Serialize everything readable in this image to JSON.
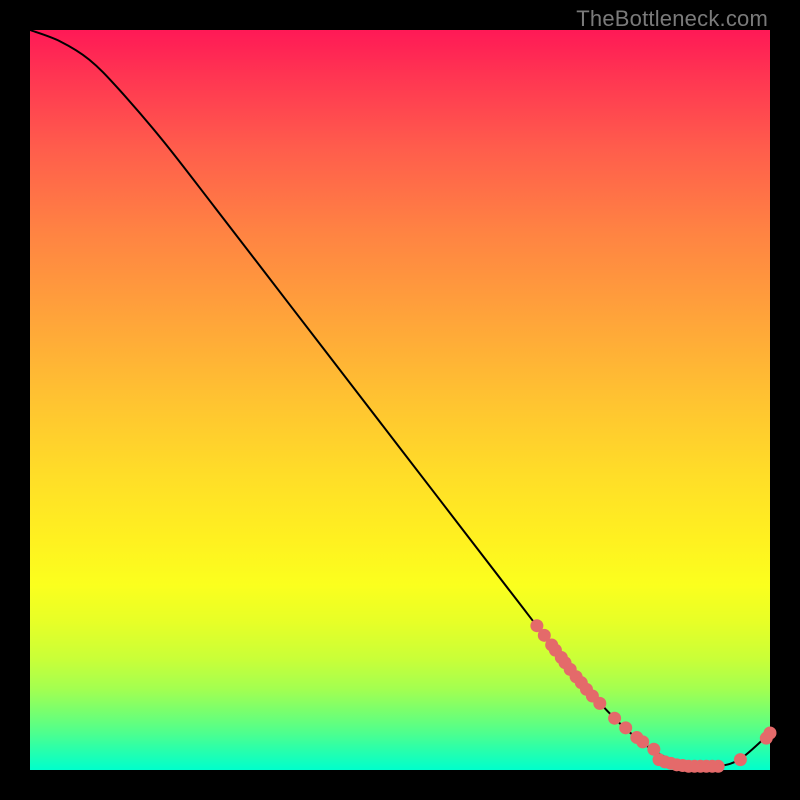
{
  "watermark": "TheBottleneck.com",
  "colors": {
    "background": "#000000",
    "marker": "#e46a6a",
    "curve": "#000000"
  },
  "chart_data": {
    "type": "line",
    "title": "",
    "xlabel": "",
    "ylabel": "",
    "xlim": [
      0,
      100
    ],
    "ylim": [
      0,
      100
    ],
    "grid": false,
    "series": [
      {
        "name": "curve",
        "x": [
          0,
          4,
          8,
          12,
          18,
          25,
          35,
          45,
          55,
          65,
          72,
          78,
          83,
          87,
          90,
          93,
          96,
          100
        ],
        "y": [
          100,
          98.5,
          96,
          92,
          85,
          76,
          63,
          50,
          37,
          24,
          15,
          8,
          3.5,
          1.2,
          0.5,
          0.5,
          1.5,
          5
        ]
      }
    ],
    "markers": {
      "name": "highlighted-points",
      "points": [
        {
          "x": 68.5,
          "y": 19.5
        },
        {
          "x": 69.5,
          "y": 18.2
        },
        {
          "x": 70.5,
          "y": 16.9
        },
        {
          "x": 71.0,
          "y": 16.2
        },
        {
          "x": 71.8,
          "y": 15.2
        },
        {
          "x": 72.3,
          "y": 14.5
        },
        {
          "x": 73.0,
          "y": 13.6
        },
        {
          "x": 73.8,
          "y": 12.6
        },
        {
          "x": 74.5,
          "y": 11.8
        },
        {
          "x": 75.2,
          "y": 10.9
        },
        {
          "x": 76.0,
          "y": 10.0
        },
        {
          "x": 77.0,
          "y": 9.0
        },
        {
          "x": 79.0,
          "y": 7.0
        },
        {
          "x": 80.5,
          "y": 5.7
        },
        {
          "x": 82.0,
          "y": 4.4
        },
        {
          "x": 82.8,
          "y": 3.8
        },
        {
          "x": 84.3,
          "y": 2.8
        },
        {
          "x": 85.0,
          "y": 1.4
        },
        {
          "x": 85.8,
          "y": 1.1
        },
        {
          "x": 86.6,
          "y": 0.9
        },
        {
          "x": 87.4,
          "y": 0.7
        },
        {
          "x": 88.2,
          "y": 0.6
        },
        {
          "x": 89.0,
          "y": 0.5
        },
        {
          "x": 89.8,
          "y": 0.5
        },
        {
          "x": 90.6,
          "y": 0.5
        },
        {
          "x": 91.4,
          "y": 0.5
        },
        {
          "x": 92.2,
          "y": 0.5
        },
        {
          "x": 93.0,
          "y": 0.5
        },
        {
          "x": 96.0,
          "y": 1.4
        },
        {
          "x": 99.5,
          "y": 4.3
        },
        {
          "x": 100.0,
          "y": 5.0
        }
      ]
    }
  }
}
